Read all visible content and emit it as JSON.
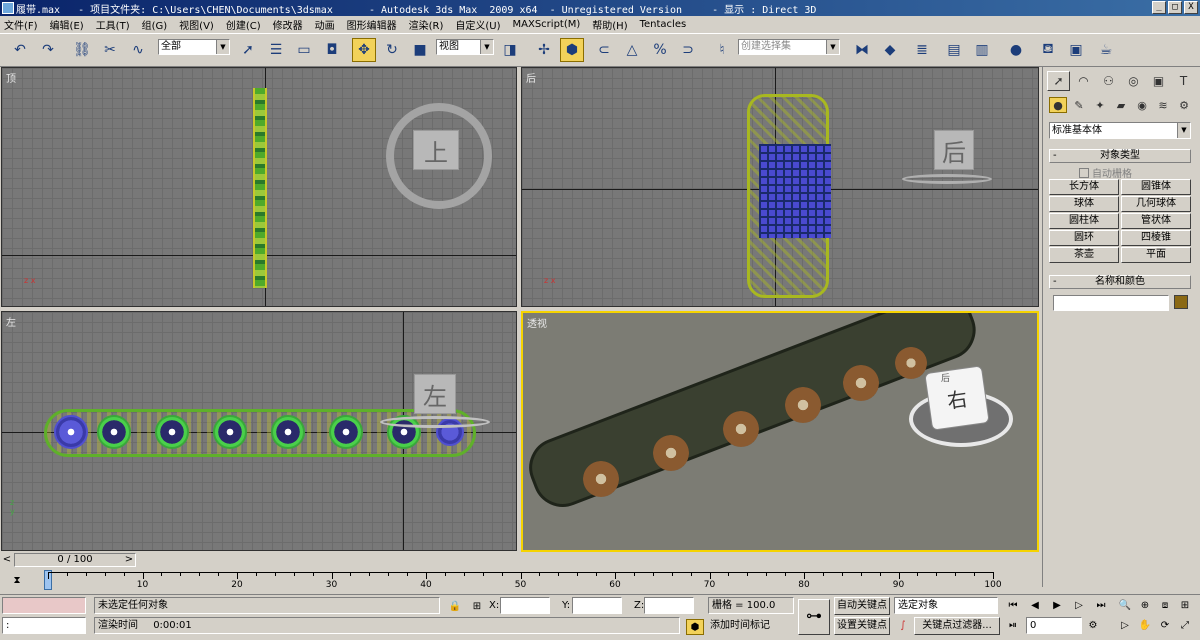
{
  "window": {
    "title": "履带.max   - 项目文件夹: C:\\Users\\CHEN\\Documents\\3dsmax      - Autodesk 3ds Max  2009 x64  - Unregistered Version     - 显示 : Direct 3D",
    "min": "_",
    "max": "□",
    "close": "X"
  },
  "menu": [
    "文件(F)",
    "编辑(E)",
    "工具(T)",
    "组(G)",
    "视图(V)",
    "创建(C)",
    "修改器",
    "动画",
    "图形编辑器",
    "渲染(R)",
    "自定义(U)",
    "MAXScript(M)",
    "帮助(H)",
    "Tentacles"
  ],
  "toolbar": {
    "selection_filter": "全部",
    "ref_coord": "视图",
    "named_sel": "创建选择集"
  },
  "viewports": {
    "top": {
      "label": "顶",
      "nav": "上"
    },
    "back": {
      "label": "后",
      "nav": "后"
    },
    "left": {
      "label": "左",
      "nav": "左"
    },
    "persp": {
      "label": "透视",
      "nav": "右",
      "nav2": "后"
    }
  },
  "command_panel": {
    "category": "标准基本体",
    "object_type_title": "对象类型",
    "autogrid": "自动栅格",
    "objects": [
      "长方体",
      "圆锥体",
      "球体",
      "几何球体",
      "圆柱体",
      "管状体",
      "圆环",
      "四棱锥",
      "茶壶",
      "平面"
    ],
    "name_color_title": "名称和颜色",
    "name_color": "#8b6914"
  },
  "timeline": {
    "slider": "0 / 100",
    "ticks": [
      "10",
      "20",
      "30",
      "40",
      "50",
      "60",
      "70",
      "80",
      "90",
      "100"
    ],
    "prev": "<",
    "next": ">"
  },
  "status": {
    "selection": "未选定任何对象",
    "render_time_label": "渲染时间",
    "render_time": "0:00:01",
    "x_label": "X:",
    "y_label": "Y:",
    "z_label": "Z:",
    "grid": "栅格 = 100.0",
    "auto_key": "自动关键点",
    "set_key": "设置关键点",
    "key_mode": "选定对象",
    "key_filters": "关键点过滤器...",
    "add_time_tag": "添加时间标记",
    "frame": "0",
    "colon": ":"
  }
}
